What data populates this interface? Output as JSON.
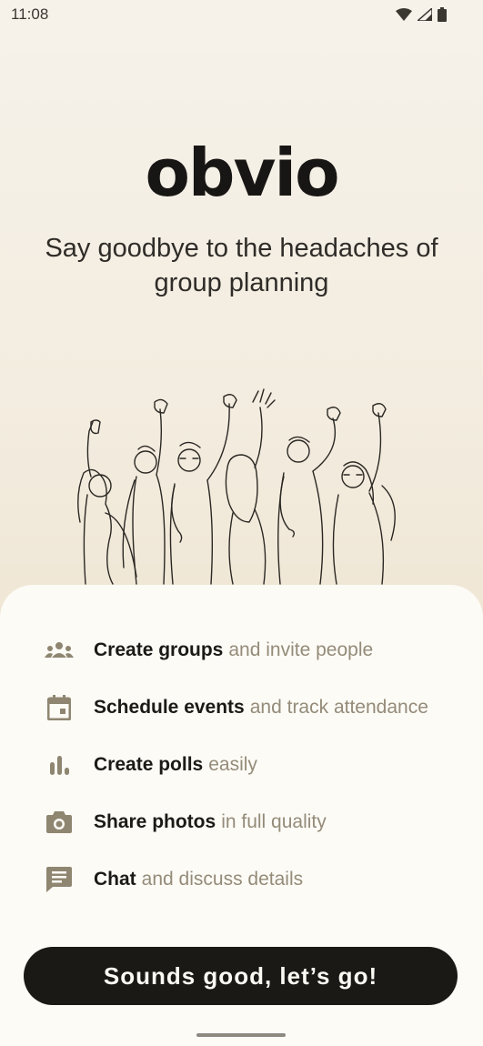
{
  "status_bar": {
    "time": "11:08",
    "icons": [
      "wifi-icon",
      "signal-icon",
      "battery-icon"
    ]
  },
  "app": {
    "name": "obvio",
    "tagline": "Say goodbye to the headaches of group planning"
  },
  "features": [
    {
      "icon": "groups-icon",
      "bold": "Create groups",
      "rest": "and invite people"
    },
    {
      "icon": "calendar-icon",
      "bold": "Schedule events",
      "rest": "and track attendance"
    },
    {
      "icon": "poll-icon",
      "bold": "Create polls",
      "rest": "easily"
    },
    {
      "icon": "camera-icon",
      "bold": "Share photos",
      "rest": "in full quality"
    },
    {
      "icon": "chat-icon",
      "bold": "Chat",
      "rest": "and discuss details"
    }
  ],
  "cta": {
    "label": "Sounds good, let’s go!"
  },
  "colors": {
    "accent_icon": "#8f8671",
    "button_bg": "#1b1916",
    "muted_text": "#948b79",
    "sheet_bg": "#fdfbf6"
  }
}
